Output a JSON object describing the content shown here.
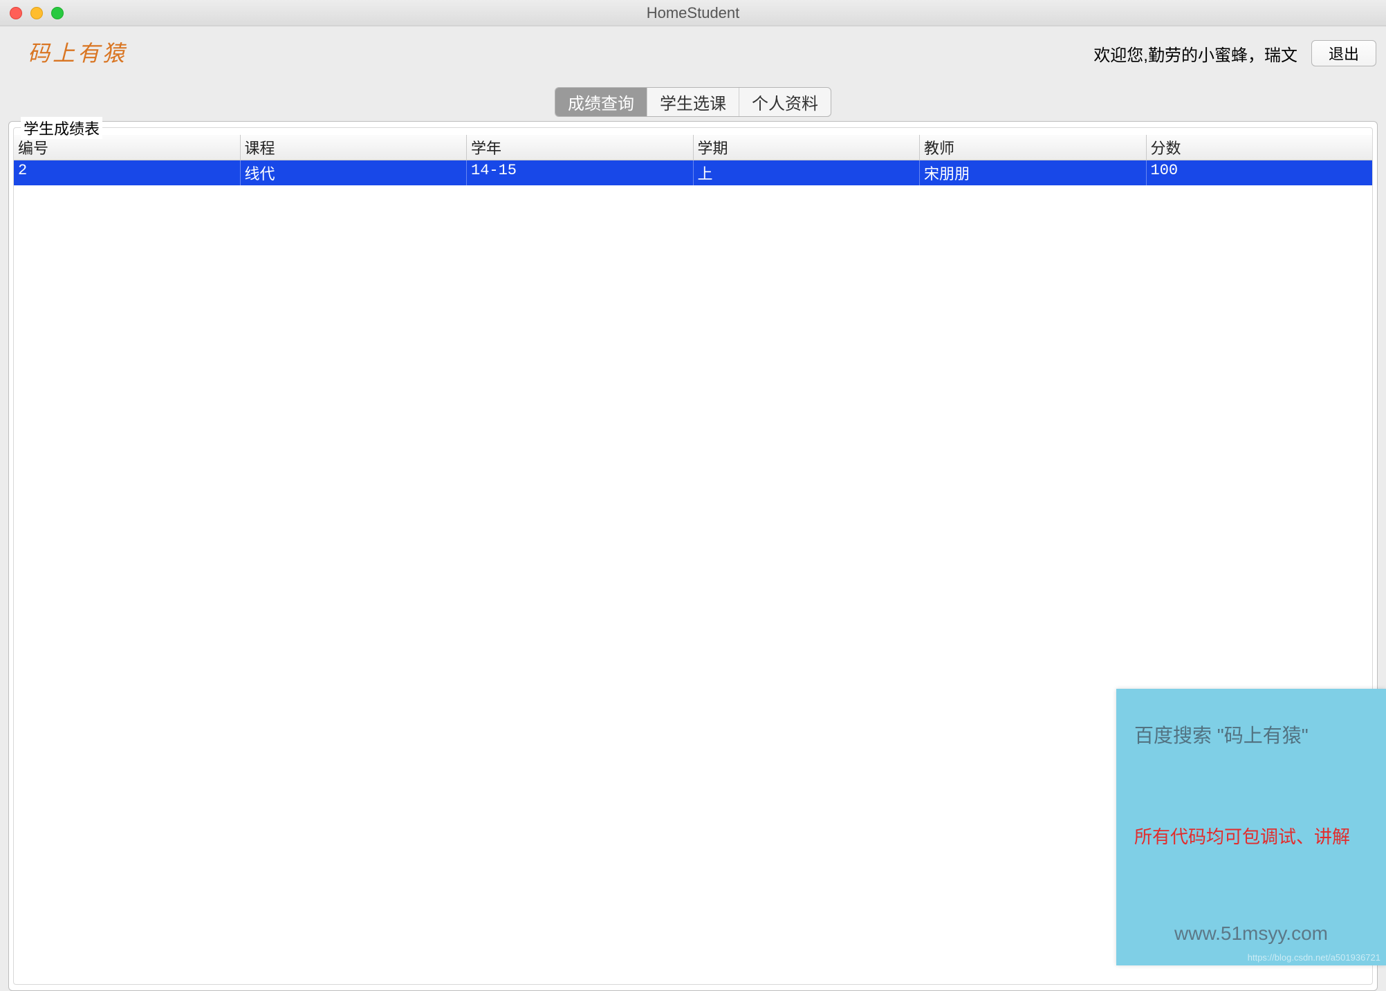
{
  "window": {
    "title": "HomeStudent"
  },
  "brand": "码上有猿",
  "header": {
    "welcome": "欢迎您,勤劳的小蜜蜂，瑞文",
    "logout_label": "退出"
  },
  "tabs": [
    {
      "label": "成绩查询",
      "active": true
    },
    {
      "label": "学生选课",
      "active": false
    },
    {
      "label": "个人资料",
      "active": false
    }
  ],
  "group": {
    "legend": "学生成绩表"
  },
  "table": {
    "columns": [
      "编号",
      "课程",
      "学年",
      "学期",
      "教师",
      "分数"
    ],
    "rows": [
      {
        "id": "2",
        "course": "线代",
        "year": "14-15",
        "term": "上",
        "teacher": "宋朋朋",
        "score": "100"
      }
    ]
  },
  "banner": {
    "line1": "百度搜索 \"码上有猿\"",
    "line2": "所有代码均可包调试、讲解",
    "line3": "www.51msyy.com",
    "watermark": "https://blog.csdn.net/a501936721"
  }
}
